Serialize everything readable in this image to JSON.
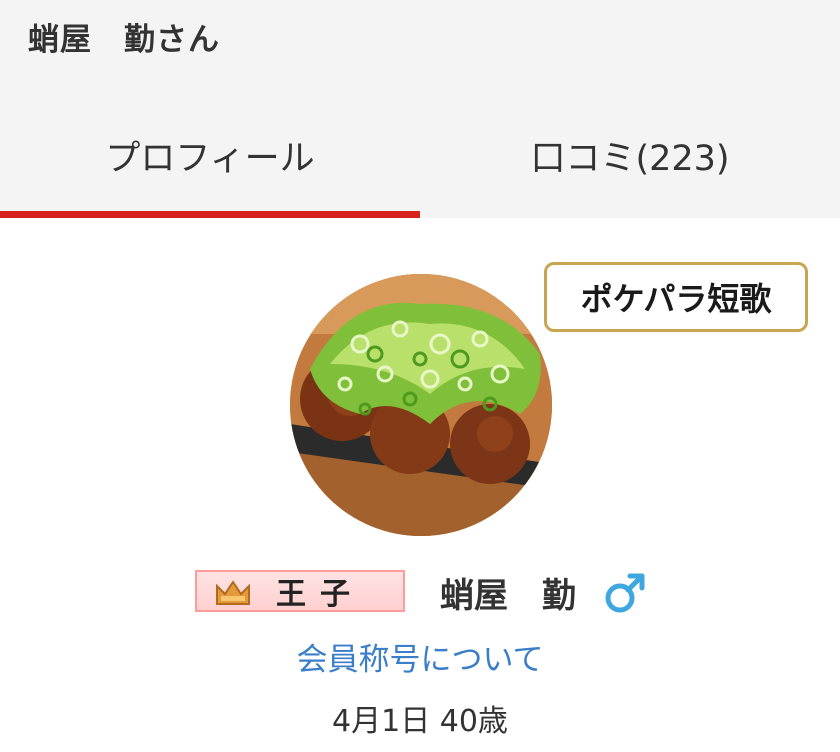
{
  "header": {
    "title": "蛸屋　勤さん"
  },
  "tabs": [
    {
      "label": "プロフィール",
      "active": true
    },
    {
      "label": "口コミ(223)",
      "active": false
    }
  ],
  "badge": {
    "label": "ポケパラ短歌"
  },
  "profile": {
    "avatar_alt": "takoyaki-photo",
    "title_badge": "王子",
    "name": "蛸屋　勤",
    "gender_icon": "male-symbol",
    "title_link": "会員称号について",
    "birth": "4月1日 40歳"
  },
  "colors": {
    "accent_red": "#d8231c",
    "link_blue": "#3a7dc8",
    "badge_gold": "#c9a451",
    "gender_blue": "#3fa7e0"
  }
}
